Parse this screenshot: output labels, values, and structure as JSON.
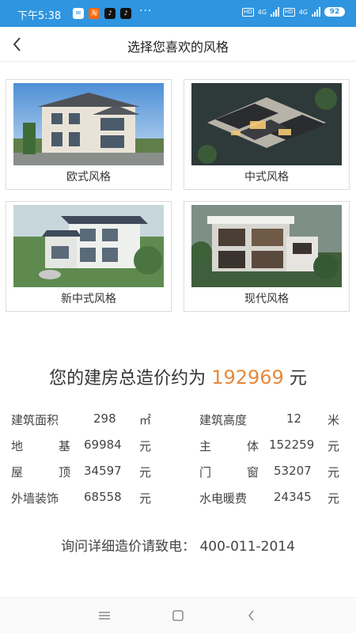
{
  "status": {
    "time": "下午5:38",
    "battery": "92",
    "network_a": "4G",
    "network_b": "4G",
    "hd": "HD",
    "more": "···"
  },
  "header": {
    "title": "选择您喜欢的风格",
    "back_icon": "chevron-left-icon"
  },
  "styles": [
    {
      "label": "欧式风格"
    },
    {
      "label": "中式风格"
    },
    {
      "label": "新中式风格"
    },
    {
      "label": "现代风格"
    }
  ],
  "estimate": {
    "prefix": "您的建房总造价约为",
    "price": "192969",
    "unit": "元"
  },
  "details": {
    "area": {
      "label": "建筑面积",
      "value": "298",
      "unit": "㎡"
    },
    "height": {
      "label": "建筑高度",
      "value": "12",
      "unit": "米"
    },
    "foundation": {
      "label_a": "地",
      "label_b": "基",
      "value": "69984",
      "unit": "元"
    },
    "main": {
      "label_a": "主",
      "label_b": "体",
      "value": "152259",
      "unit": "元"
    },
    "roof": {
      "label_a": "屋",
      "label_b": "顶",
      "value": "34597",
      "unit": "元"
    },
    "doors": {
      "label_a": "门",
      "label_b": "窗",
      "value": "53207",
      "unit": "元"
    },
    "wall": {
      "label": "外墙装饰",
      "value": "68558",
      "unit": "元"
    },
    "utilities": {
      "label": "水电暖费",
      "value": "24345",
      "unit": "元"
    }
  },
  "contact": {
    "text": "询问详细造价请致电：",
    "phone": "400-011-2014"
  },
  "colors": {
    "status_bar": "#2f95e0",
    "price": "#e8883a"
  }
}
